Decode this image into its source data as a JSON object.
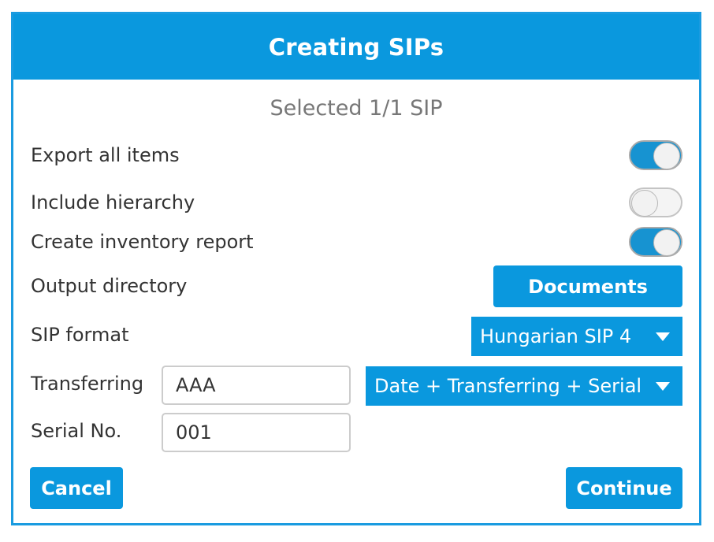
{
  "dialog": {
    "title": "Creating SIPs",
    "subtitle": "Selected 1/1 SIP"
  },
  "options": {
    "export_all_items": {
      "label": "Export all items",
      "enabled": true
    },
    "include_hierarchy": {
      "label": "Include hierarchy",
      "enabled": false
    },
    "create_inventory_report": {
      "label": "Create inventory report",
      "enabled": true
    }
  },
  "output_directory": {
    "label": "Output directory",
    "button_label": "Documents"
  },
  "sip_format": {
    "label": "SIP format",
    "selected": "Hungarian SIP 4"
  },
  "transferring": {
    "label": "Transferring",
    "value": "AAA",
    "naming_pattern": "Date + Transferring + Serial"
  },
  "serial_no": {
    "label": "Serial No.",
    "value": "001"
  },
  "actions": {
    "cancel_label": "Cancel",
    "continue_label": "Continue"
  },
  "colors": {
    "accent": "#0a98de",
    "border": "#1a9be0",
    "toggle_on": "#1793d1"
  },
  "icons": {
    "dropdown": "chevron-down-icon"
  }
}
